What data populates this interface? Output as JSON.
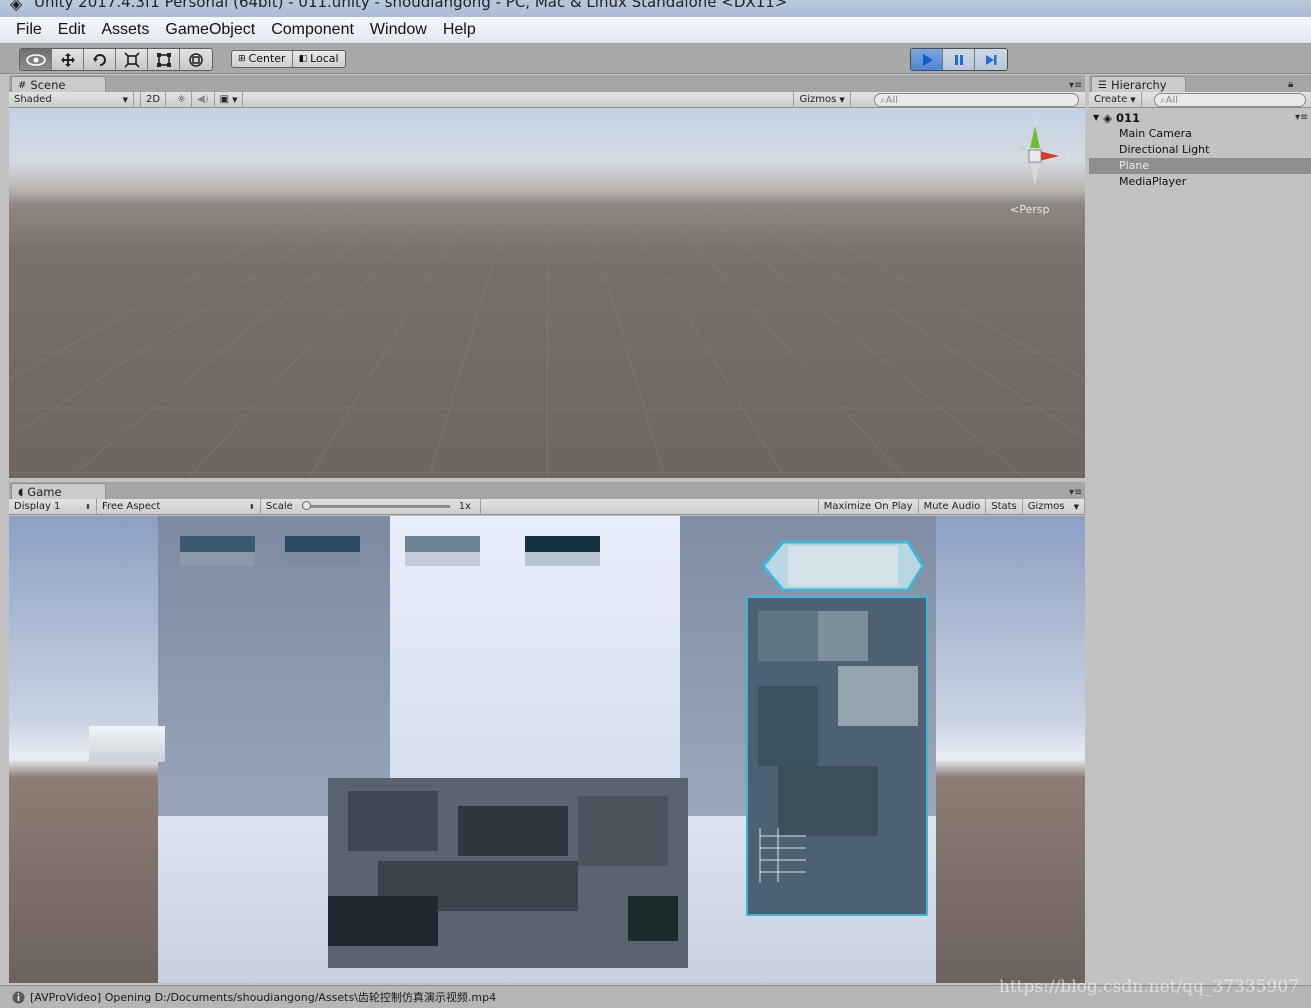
{
  "window": {
    "title": "Unity 2017.4.3f1 Personal (64bit) - 011.unity - shoudiangong - PC, Mac & Linux Standalone <DX11>"
  },
  "menu": [
    "File",
    "Edit",
    "Assets",
    "GameObject",
    "Component",
    "Window",
    "Help"
  ],
  "toolbar": {
    "tools": [
      "hand-tool",
      "move-tool",
      "rotate-tool",
      "scale-tool",
      "rect-tool",
      "transform-tool"
    ],
    "pivot_label": "Center",
    "space_label": "Local",
    "play_state": "playing"
  },
  "scene": {
    "tab_label": "Scene",
    "shading_mode": "Shaded",
    "mode_2d": "2D",
    "gizmos_label": "Gizmos",
    "search_placeholder": "All",
    "projection_label": "Persp",
    "axis_y": "y",
    "axis_x": "x"
  },
  "game": {
    "tab_label": "Game",
    "display": "Display 1",
    "aspect": "Free Aspect",
    "scale_label": "Scale",
    "scale_value": "1x",
    "scale_fraction": 0.0,
    "maximize_label": "Maximize On Play",
    "mute_label": "Mute Audio",
    "stats_label": "Stats",
    "gizmos_label": "Gizmos"
  },
  "hierarchy": {
    "tab_label": "Hierarchy",
    "create_label": "Create",
    "search_placeholder": "All",
    "scene_name": "011",
    "items": [
      {
        "label": "Main Camera",
        "selected": false
      },
      {
        "label": "Directional Light",
        "selected": false
      },
      {
        "label": "Plane",
        "selected": true
      },
      {
        "label": "MediaPlayer",
        "selected": false
      }
    ]
  },
  "status": {
    "message": "[AVProVideo] Opening D:/Documents/shoudiangong/Assets\\齿轮控制仿真演示视频.mp4"
  },
  "watermark": "https://blog.csdn.net/qq_37335907",
  "colors": {
    "play_accent": "#1b6fd6",
    "selection": "#8f8f8f",
    "hud_cyan": "#3fb6d6"
  }
}
